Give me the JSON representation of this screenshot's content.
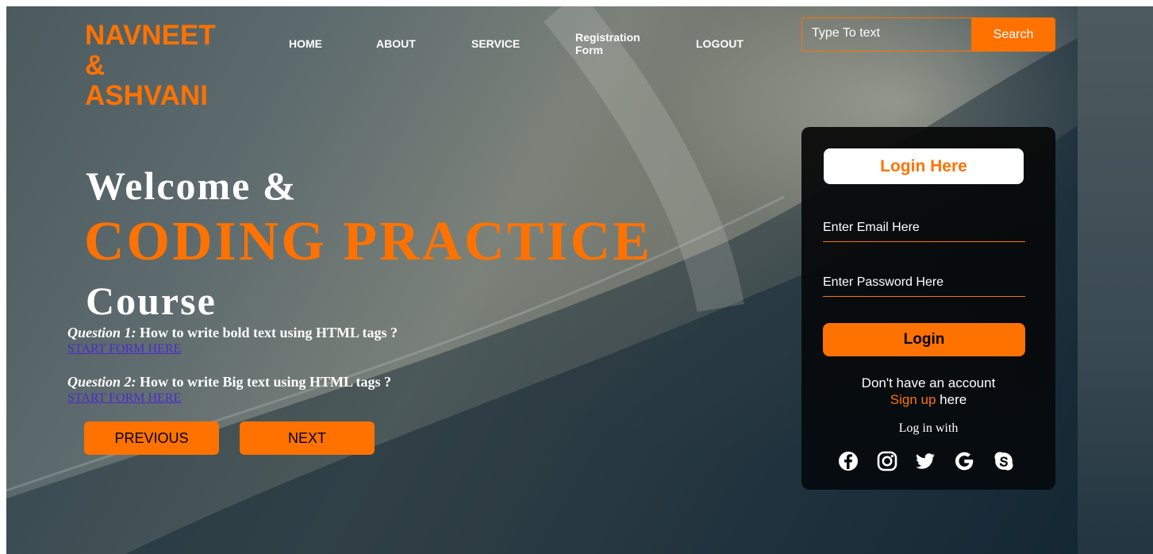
{
  "brand": {
    "line1": "NAVNEET",
    "line2": "&",
    "line3": "ASHVANI",
    "color": "#ff7200"
  },
  "nav": {
    "home": "HOME",
    "about": "ABOUT",
    "service": "SERVICE",
    "registration_line1": "Registration",
    "registration_line2": "Form",
    "logout": "LOGOUT"
  },
  "search": {
    "value": "Type To text",
    "button": "Search"
  },
  "hero": {
    "welcome": "Welcome &",
    "highlight": "CODING PRACTICE",
    "course": "Course"
  },
  "questions": [
    {
      "label": "Question 1:",
      "text": " How to write bold text using HTML tags ?",
      "link": "START FORM HERE"
    },
    {
      "label": "Question 2:",
      "text": " How to write Big text using HTML tags ?",
      "link": "START FORM HERE"
    }
  ],
  "pager": {
    "previous": "PREVIOUS",
    "next": "NEXT"
  },
  "login": {
    "title": "Login Here",
    "email_placeholder": "Enter Email Here",
    "password_placeholder": "Enter Password Here",
    "button": "Login",
    "no_account": "Don't have an account",
    "signup_link": "Sign up",
    "signup_suffix": " here",
    "login_with": "Log in with",
    "social_icons": [
      "facebook-icon",
      "instagram-icon",
      "twitter-icon",
      "google-icon",
      "skype-icon"
    ]
  },
  "colors": {
    "accent": "#ff7200",
    "card": "#0a0a0a",
    "link": "#4b2bd0"
  }
}
